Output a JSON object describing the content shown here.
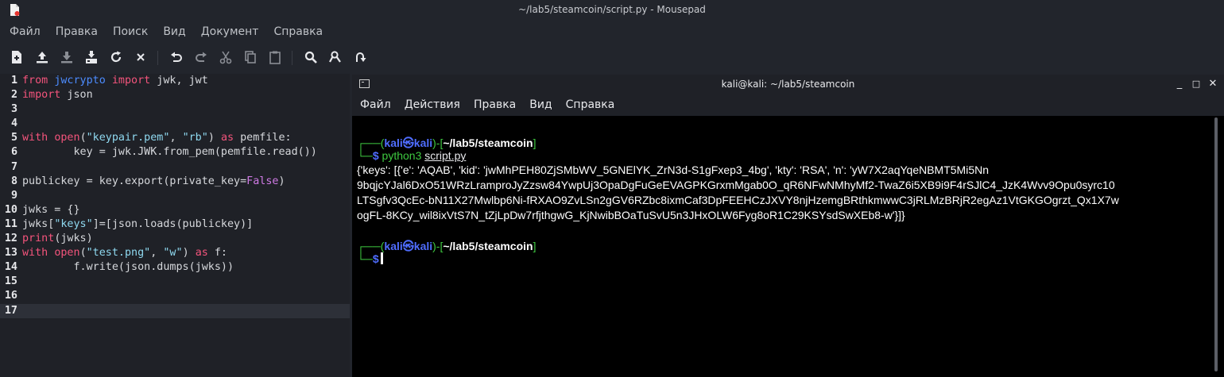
{
  "window": {
    "title": "~/lab5/steamcoin/script.py - Mousepad"
  },
  "menu": [
    "Файл",
    "Правка",
    "Поиск",
    "Вид",
    "Документ",
    "Справка"
  ],
  "toolbar_icons": [
    "new-document-icon",
    "open-icon",
    "save-icon",
    "save-as-icon",
    "reload-icon",
    "close-icon",
    "undo-icon",
    "redo-icon",
    "cut-icon",
    "copy-icon",
    "paste-icon",
    "find-icon",
    "find-replace-icon",
    "goto-icon"
  ],
  "editor": {
    "line_numbers": [
      "1",
      "2",
      "3",
      "4",
      "5",
      "6",
      "7",
      "8",
      "9",
      "10",
      "11",
      "12",
      "13",
      "14",
      "15",
      "16",
      "17"
    ],
    "current_line": 17,
    "lines": [
      [
        [
          "kw",
          "from"
        ],
        [
          "t",
          " "
        ],
        [
          "mod",
          "jwcrypto"
        ],
        [
          "t",
          " "
        ],
        [
          "kw",
          "import"
        ],
        [
          "t",
          " jwk, jwt"
        ]
      ],
      [
        [
          "kw",
          "import"
        ],
        [
          "t",
          " json"
        ]
      ],
      [],
      [],
      [
        [
          "kw",
          "with"
        ],
        [
          "t",
          " "
        ],
        [
          "fn",
          "open"
        ],
        [
          "t",
          "("
        ],
        [
          "str",
          "\"keypair.pem\""
        ],
        [
          "t",
          ", "
        ],
        [
          "str",
          "\"rb\""
        ],
        [
          "t",
          ") "
        ],
        [
          "kw",
          "as"
        ],
        [
          "t",
          " pemfile:"
        ]
      ],
      [
        [
          "t",
          "        key = jwk.JWK.from_pem(pemfile.read())"
        ]
      ],
      [],
      [
        [
          "t",
          "publickey = key.export(private_key="
        ],
        [
          "bool",
          "False"
        ],
        [
          "t",
          ")"
        ]
      ],
      [],
      [
        [
          "t",
          "jwks = {}"
        ]
      ],
      [
        [
          "t",
          "jwks["
        ],
        [
          "str",
          "\"keys\""
        ],
        [
          "t",
          "]=[json.loads(publickey)]"
        ]
      ],
      [
        [
          "fn",
          "print"
        ],
        [
          "t",
          "(jwks)"
        ]
      ],
      [
        [
          "kw",
          "with"
        ],
        [
          "t",
          " "
        ],
        [
          "fn",
          "open"
        ],
        [
          "t",
          "("
        ],
        [
          "str",
          "\"test.png\""
        ],
        [
          "t",
          ", "
        ],
        [
          "str",
          "\"w\""
        ],
        [
          "t",
          ") "
        ],
        [
          "kw",
          "as"
        ],
        [
          "t",
          " f:"
        ]
      ],
      [
        [
          "t",
          "        f.write(json.dumps(jwks))"
        ]
      ],
      [],
      [],
      []
    ]
  },
  "terminal": {
    "title": "kali@kali: ~/lab5/steamcoin",
    "window_buttons": [
      "_",
      "□",
      "✕"
    ],
    "menu": [
      "Файл",
      "Действия",
      "Правка",
      "Вид",
      "Справка"
    ],
    "prompt1": {
      "corner": "┌──(",
      "user": "kali㉿",
      "host": "kali",
      "mid": ")-[",
      "path": "~/lab5/steamcoin",
      "end": "]",
      "arrow": "└─",
      "dollar": "$",
      "command": "python3",
      "arg": "script.py"
    },
    "output": [
      "{'keys': [{'e': 'AQAB', 'kid': 'jwMhPEH80ZjSMbWV_5GNElYK_ZrN3d-S1gFxep3_4bg', 'kty': 'RSA', 'n': 'yW7X2aqYqeNBMT5Mi5Nn",
      "9bqjcYJal6DxO51WRzLramproJyZzsw84YwpUj3OpaDgFuGeEVAGPKGrxmMgab0O_qR6NFwNMhyMf2-TwaZ6i5XB9i9F4rSJlC4_JzK4Wvv9Opu0syrc10",
      "LTSgfv3QcEc-bN11X27Mwlbp6Ni-fRXAO9ZvLSn2gGV6RZbc8ixmCaf3DpFEEHCzJXVY8njHzemgBRthkmwwC3jRLMzBRjR2egAz1VtGKGOgrzt_Qx1X7w",
      "ogFL-8KCy_wil8ixVtS7N_tZjLpDw7rfjthgwG_KjNwibBOaTuSvU5n3JHxOLW6Fyg8oR1C29KSYsdSwXEb8-w'}]}"
    ],
    "prompt2": {
      "corner": "┌──(",
      "user": "kali㉿",
      "host": "kali",
      "mid": ")-[",
      "path": "~/lab5/steamcoin",
      "end": "]",
      "arrow": "└─",
      "dollar": "$"
    }
  }
}
